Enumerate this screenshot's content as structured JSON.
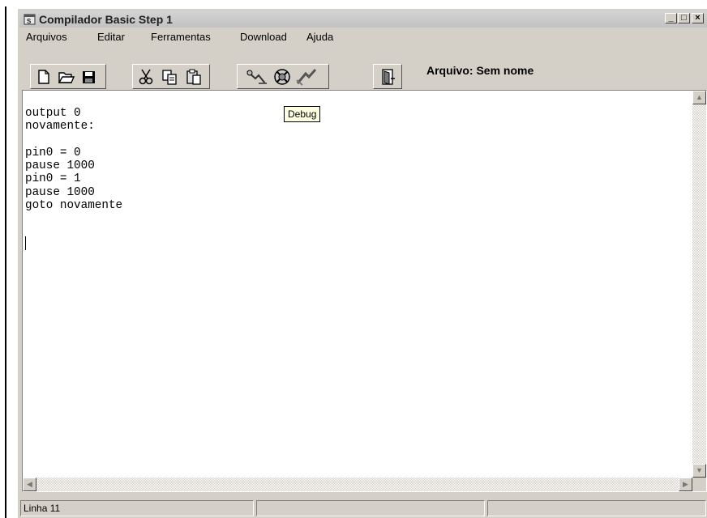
{
  "window": {
    "title": "Compilador Basic Step 1",
    "minimize": "_",
    "maximize": "□",
    "close": "×"
  },
  "menu": [
    "Arquivos",
    "Editar",
    "Ferramentas",
    "Download",
    "Ajuda"
  ],
  "toolbar": {
    "buttons": [
      "new-file-icon",
      "open-folder-icon",
      "save-icon",
      "cut-icon",
      "copy-icon",
      "paste-icon",
      "compile-icon",
      "debug-icon",
      "run-icon",
      "exit-icon"
    ],
    "filename_label": "Arquivo: Sem nome"
  },
  "editor": {
    "code": "output 0\nnovamente:\n\npin0 = 0\npause 1000\npin0 = 1\npause 1000\ngoto novamente"
  },
  "tooltip": "Debug",
  "statusbar": {
    "line": "Linha 11",
    "panel2": "",
    "panel3": ""
  }
}
